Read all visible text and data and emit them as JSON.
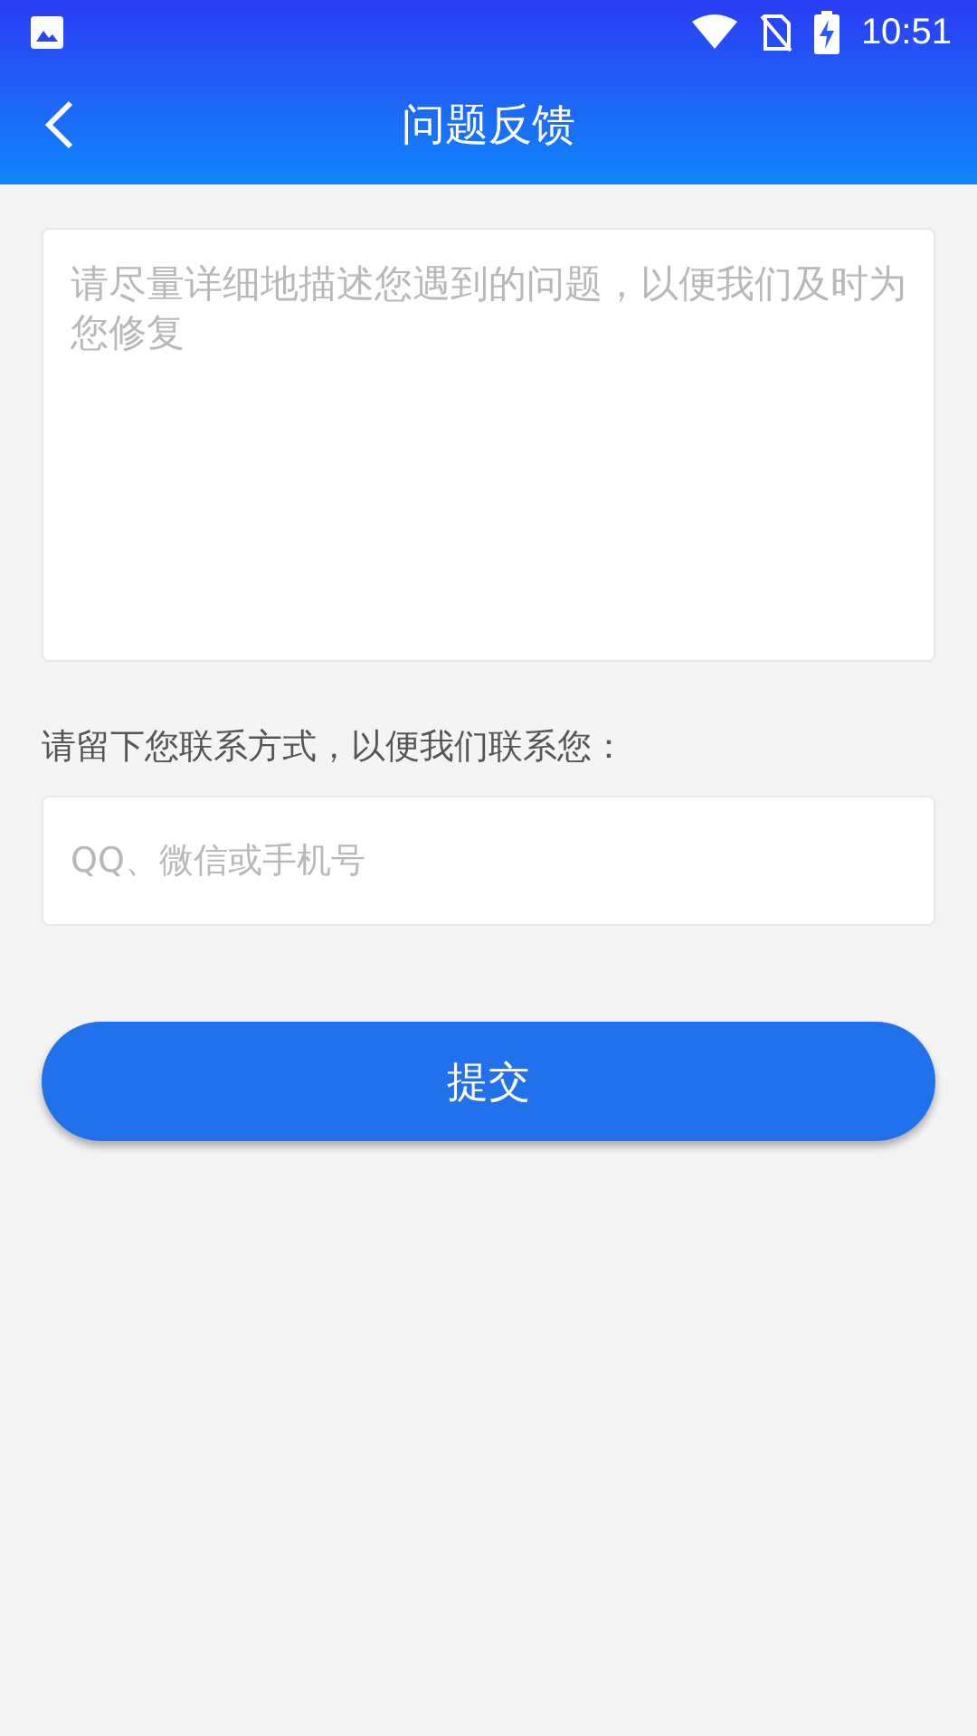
{
  "status_bar": {
    "time": "10:51"
  },
  "header": {
    "title": "问题反馈"
  },
  "description": {
    "placeholder": "请尽量详细地描述您遇到的问题，以便我们及时为您修复"
  },
  "contact": {
    "label": "请留下您联系方式，以便我们联系您：",
    "placeholder": "QQ、微信或手机号"
  },
  "submit_button": "提交"
}
